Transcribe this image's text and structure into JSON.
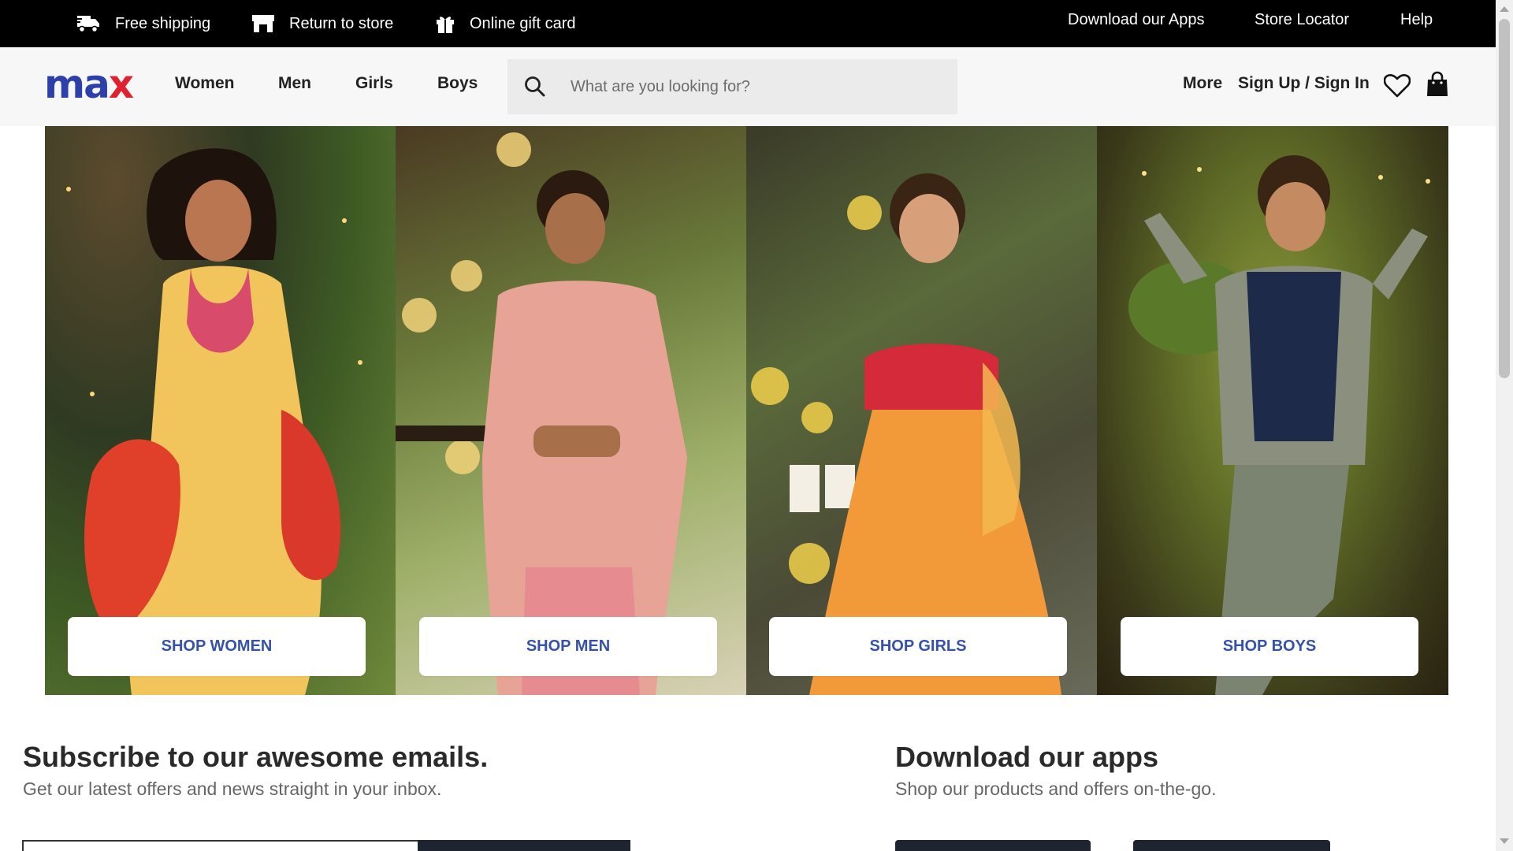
{
  "topbar": {
    "left_items": [
      {
        "label": "Free shipping",
        "icon": "truck-icon"
      },
      {
        "label": "Return to store",
        "icon": "store-icon"
      },
      {
        "label": "Online gift card",
        "icon": "gift-icon"
      }
    ],
    "right_links": [
      "Download our Apps",
      "Store Locator",
      "Help"
    ]
  },
  "header": {
    "logo": {
      "part1": "ma",
      "part2": "x"
    },
    "nav": [
      "Women",
      "Men",
      "Girls",
      "Boys"
    ],
    "search": {
      "placeholder": "What are you looking for?",
      "icon": "search-icon"
    },
    "more_label": "More",
    "auth_label": "Sign Up / Sign In",
    "wishlist_icon": "heart-icon",
    "bag_icon": "shopping-bag-icon"
  },
  "hero": {
    "panels": [
      {
        "button": "SHOP WOMEN"
      },
      {
        "button": "SHOP MEN"
      },
      {
        "button": "SHOP GIRLS"
      },
      {
        "button": "SHOP BOYS"
      }
    ]
  },
  "subscribe": {
    "title": "Subscribe to our awesome emails.",
    "subtitle": "Get our latest offers and news straight in your inbox."
  },
  "apps": {
    "title": "Download our apps",
    "subtitle": "Shop our products and offers on-the-go."
  },
  "colors": {
    "brand_blue": "#2d3fa8",
    "brand_red": "#e0212f",
    "shop_button_text": "#3552a8",
    "topbar_bg": "#000000"
  }
}
